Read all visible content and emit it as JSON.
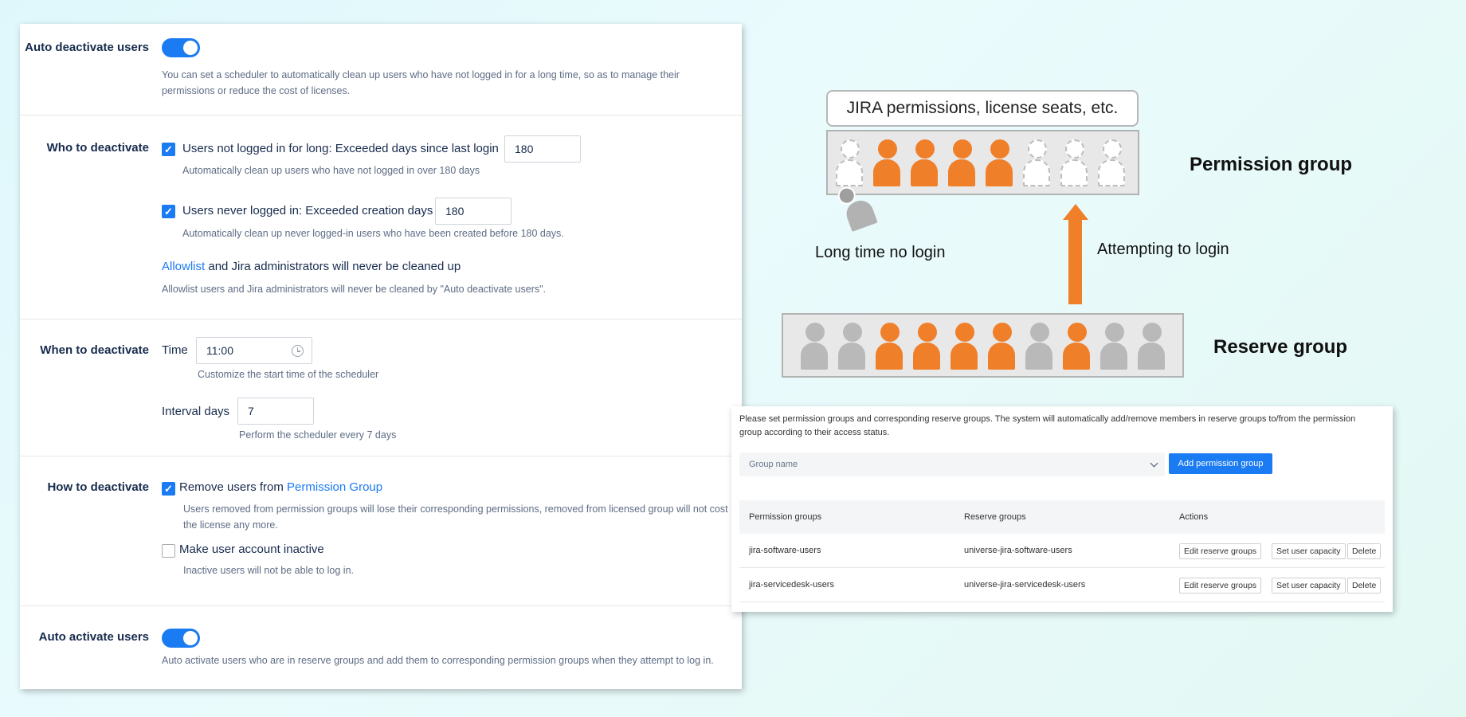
{
  "settings": {
    "auto_deactivate": {
      "label": "Auto deactivate users",
      "enabled": true,
      "description": "You can set a scheduler to automatically clean up users who have not logged in for a long time, so as to manage their permissions or reduce the cost of licenses."
    },
    "who": {
      "label": "Who to deactivate",
      "rule1": {
        "checked": true,
        "label": "Users not logged in for long: Exceeded days since last login",
        "value": "180",
        "hint": "Automatically clean up users who have not logged in over 180 days"
      },
      "rule2": {
        "checked": true,
        "label": "Users never logged in: Exceeded creation days",
        "value": "180",
        "hint": "Automatically clean up never logged-in users who have been created before 180 days."
      },
      "allowlist_link": "Allowlist",
      "allowlist_rest": " and Jira administrators will never be cleaned up",
      "allowlist_hint": "Allowlist users and Jira administrators will never be cleaned by \"Auto deactivate users\"."
    },
    "when": {
      "label": "When to deactivate",
      "time_label": "Time",
      "time_value": "11:00",
      "time_hint": "Customize the start time of the scheduler",
      "interval_label": "Interval days",
      "interval_value": "7",
      "interval_hint": "Perform the scheduler every 7 days"
    },
    "how": {
      "label": "How to deactivate",
      "remove": {
        "checked": true,
        "label_prefix": "Remove users from ",
        "label_link": "Permission Group",
        "hint": "Users removed from permission groups will lose their corresponding permissions, removed from licensed group will not cost the license any more."
      },
      "inactive": {
        "checked": false,
        "label": "Make user account inactive",
        "hint": "Inactive users will not be able to log in."
      }
    },
    "auto_activate": {
      "label": "Auto activate users",
      "enabled": true,
      "description": "Auto activate users who are in reserve groups and add them to corresponding permission groups when they attempt to log in."
    }
  },
  "diagram": {
    "box_title": "JIRA permissions, license seats, etc.",
    "permission_group_label": "Permission group",
    "reserve_group_label": "Reserve group",
    "long_time_label": "Long time no login",
    "attempting_label": "Attempting to login",
    "permission_slots": [
      "empty",
      "orange",
      "orange",
      "orange",
      "orange",
      "empty",
      "empty",
      "empty"
    ],
    "reserve_members": [
      "gray",
      "gray",
      "orange",
      "orange",
      "orange",
      "orange",
      "gray",
      "orange",
      "gray",
      "gray"
    ],
    "colors": {
      "active": "#f07f2a",
      "inactive": "#b9b9b9",
      "arrow": "#f07f2a"
    }
  },
  "groups_panel": {
    "description": "Please set permission groups and corresponding reserve groups. The system will automatically add/remove members in reserve groups to/from the permission group according to their access status.",
    "select_placeholder": "Group name",
    "add_button": "Add permission group",
    "columns": [
      "Permission groups",
      "Reserve groups",
      "Actions"
    ],
    "rows": [
      {
        "permission": "jira-software-users",
        "reserve": "universe-jira-software-users"
      },
      {
        "permission": "jira-servicedesk-users",
        "reserve": "universe-jira-servicedesk-users"
      }
    ],
    "actions": [
      "Edit reserve groups",
      "Set user capacity",
      "Delete"
    ]
  }
}
